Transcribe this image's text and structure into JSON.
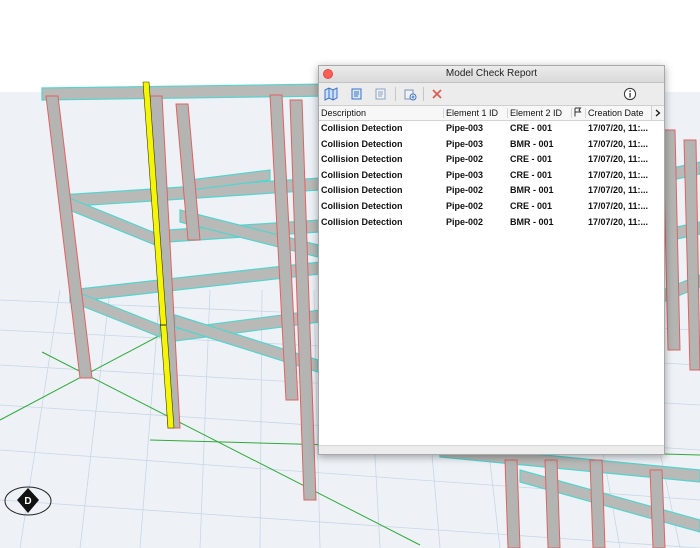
{
  "window": {
    "title": "Model Check Report"
  },
  "toolbar": {
    "icons": [
      "map-icon",
      "filter-icon",
      "filter-dim-icon",
      "add-icon",
      "delete-icon",
      "info-icon"
    ],
    "delete_color": "#e2574c",
    "accent_color": "#3b72c5"
  },
  "table": {
    "headers": {
      "description": "Description",
      "element1": "Element 1 ID",
      "element2": "Element 2 ID",
      "creation_date": "Creation Date"
    },
    "rows": [
      {
        "description": "Collision Detection",
        "element1": "Pipe-003",
        "element2": "CRE - 001",
        "date": "17/07/20, 11:..."
      },
      {
        "description": "Collision Detection",
        "element1": "Pipe-003",
        "element2": "BMR - 001",
        "date": "17/07/20, 11:..."
      },
      {
        "description": "Collision Detection",
        "element1": "Pipe-002",
        "element2": "CRE - 001",
        "date": "17/07/20, 11:..."
      },
      {
        "description": "Collision Detection",
        "element1": "Pipe-003",
        "element2": "CRE - 001",
        "date": "17/07/20, 11:..."
      },
      {
        "description": "Collision Detection",
        "element1": "Pipe-002",
        "element2": "BMR - 001",
        "date": "17/07/20, 11:..."
      },
      {
        "description": "Collision Detection",
        "element1": "Pipe-002",
        "element2": "CRE - 001",
        "date": "17/07/20, 11:..."
      },
      {
        "description": "Collision Detection",
        "element1": "Pipe-002",
        "element2": "BMR - 001",
        "date": "17/07/20, 11:..."
      }
    ]
  },
  "viewport": {
    "marker_label": "D",
    "pipe_color": "#f5f50a",
    "beam_color": "#b9bab8",
    "edge_color": "#52d4cf",
    "edge_alt_color": "#e06262",
    "grid_color": "#c9d6e6",
    "axis_color": "#2faa3a"
  }
}
